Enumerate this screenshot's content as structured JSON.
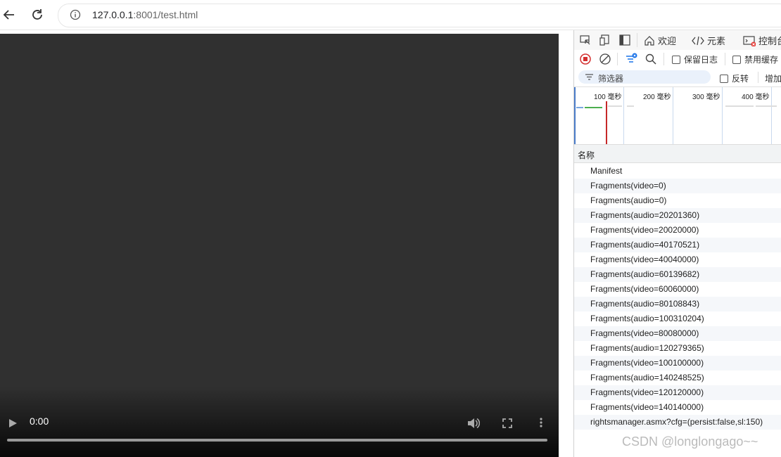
{
  "browser": {
    "url_host": "127.0.0.1",
    "url_rest": ":8001/test.html",
    "back_icon": "arrow-left-icon",
    "reload_icon": "reload-icon",
    "info_icon": "info-icon"
  },
  "video": {
    "time": "0:00",
    "progress": 0
  },
  "devtools": {
    "tabs": {
      "welcome": "欢迎",
      "elements": "元素",
      "console": "控制台"
    },
    "toolbar": {
      "preserve_log": "保留日志",
      "disable_cache": "禁用缓存"
    },
    "filter": {
      "placeholder": "筛选器",
      "invert": "反转",
      "more": "增加"
    },
    "timeline": {
      "labels": [
        "100 毫秒",
        "200 毫秒",
        "300 毫秒",
        "400 毫秒"
      ]
    },
    "table": {
      "name_header": "名称",
      "requests": [
        "Manifest",
        "Fragments(video=0)",
        "Fragments(audio=0)",
        "Fragments(audio=20201360)",
        "Fragments(video=20020000)",
        "Fragments(audio=40170521)",
        "Fragments(video=40040000)",
        "Fragments(audio=60139682)",
        "Fragments(video=60060000)",
        "Fragments(audio=80108843)",
        "Fragments(audio=100310204)",
        "Fragments(video=80080000)",
        "Fragments(audio=120279365)",
        "Fragments(video=100100000)",
        "Fragments(audio=140248525)",
        "Fragments(video=120120000)",
        "Fragments(video=140140000)",
        "rightsmanager.asmx?cfg=(persist:false,sl:150)"
      ]
    }
  },
  "watermark": "CSDN @longlongago~~"
}
